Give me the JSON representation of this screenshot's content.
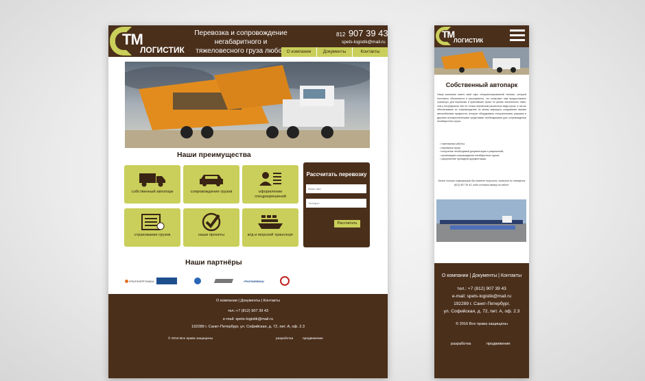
{
  "colors": {
    "brown": "#4a2f1b",
    "olive": "#c9cf5a",
    "white": "#ffffff"
  },
  "brand": {
    "tm": "ТМ",
    "name": "ЛОГИСТИК"
  },
  "desktop": {
    "slogan": "Перевозка и сопровождение негабаритного и тяжеловесного груза любой сложности",
    "phone_code": "812",
    "phone_number": "907 39 43",
    "email": "spets-logistik@mail.ru",
    "nav": [
      "О компании",
      "Документы",
      "Контакты"
    ],
    "advantages_title": "Наши преимущества",
    "tiles": [
      {
        "icon": "truck-icon",
        "label": "собственный автопарк"
      },
      {
        "icon": "car-icon",
        "label": "сопровождение грузов"
      },
      {
        "icon": "document-person-icon",
        "label": "оформление спецразрешений"
      },
      {
        "icon": "checklist-icon",
        "label": "страхование грузов"
      },
      {
        "icon": "checkmark-icon",
        "label": "наши проекты"
      },
      {
        "icon": "ship-icon",
        "label": "ж/д и морской транспорт"
      }
    ],
    "calc": {
      "title": "Рассчитать перевозку",
      "name_placeholder": "Ваше имя",
      "phone_placeholder": "Телефон",
      "button": "Рассчитать"
    },
    "partners_title": "Наши партнёры",
    "partners": [
      {
        "icon": "partner-logo-1",
        "label": "УРАЛЭНЕРГОМАШ"
      },
      {
        "icon": "partner-logo-2",
        "label": ""
      },
      {
        "icon": "partner-logo-3",
        "label": ""
      },
      {
        "icon": "partner-logo-4",
        "label": ""
      },
      {
        "icon": "partner-logo-5",
        "label": "УРАЛХИММАШ"
      },
      {
        "icon": "partner-logo-6",
        "label": ""
      }
    ],
    "footer": {
      "nav": "О компании | Документы | Контакты",
      "phone": "тел.:+7 (812) 907 39 43",
      "email": "e-mail: spets-logistik@mail.ru",
      "address": "192289 г. Санкт-Петербург, ул. Софийская, д. 72, пит. А, оф. 2.3",
      "copyright": "© 2016  Все права защищены",
      "dev": "разработка",
      "promo": "продвижение"
    }
  },
  "mobile": {
    "title": "Собственный автопарк",
    "intro": "Наша компания имеет свой парк специализированной техники, который постоянно обновляется и расширяется, что позволяет нам предоставлять транспорт для перевозки в кратчайшие сроки по ценам значительно ниже, чем у посредников. Мы не только перевозим различного вида грузы, а так же обеспечиваем их сопровождение по всему маршруту следования своими автомобилями прикрытия, которые оборудованы спецсигналами, рациями и другими вспомогательными средствами необходимыми для сопровождения негабаритного груза.",
    "list": [
      "такелажные работы;",
      "перевалки груза;",
      "получение необходимой документации и разрешений;",
      "организация сопровождения негабаритных грузов;",
      "оформление проездной документации."
    ],
    "note": "Более точную информацию Вы можете получить, позвонив по телефону (812) 907 39 43, либо оставив заявку на сайте.",
    "footer": {
      "nav": "О компании | Документы | Контакты",
      "phone": "тел.: +7 (812) 907 39 43",
      "email": "e-mail: spets-logistik@mail.ru",
      "city": "192289 г. Санкт-Петербург,",
      "street": "ул. Софийская, д. 72, пит. А, оф. 2.3",
      "copyright": "© 2016  Все права защищены",
      "dev": "разработка",
      "promo": "продвижение"
    }
  }
}
